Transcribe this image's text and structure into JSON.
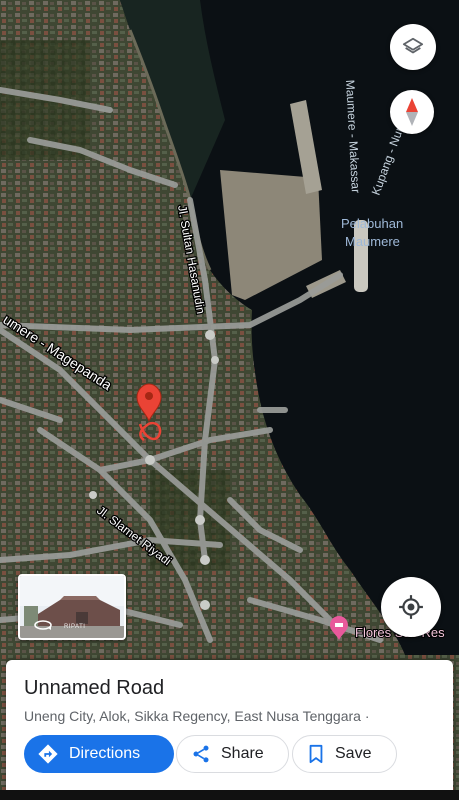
{
  "map": {
    "labels": {
      "road_sultan_hasanudin": "Jl. Sultan Hasanudin",
      "road_maumere_magepanda": "umere - Magepanda",
      "road_slamet_riyadi": "Jl. Slamet Riyadi",
      "sea_route_makassar": "Maumere - Makassar",
      "sea_route_kupang": "Kupang - Num",
      "port_name_line1": "Pelabuhan",
      "port_name_line2": "Maumere",
      "poi_flores_label": "Flores Sao Res"
    },
    "colors": {
      "pin": "#ea4335",
      "poi_pin": "#e8599b",
      "sea": "#0b1014",
      "land": "#3e4631",
      "road": "#9a9c99"
    },
    "selected_area_outline": "red"
  },
  "controls": {
    "layers_icon": "layers-icon",
    "compass_icon": "compass-icon",
    "location_icon": "my-location-icon"
  },
  "streetview": {
    "watermark": "RIPATI"
  },
  "place": {
    "title": "Unnamed Road",
    "address": "Uneng City, Alok, Sikka Regency, East Nusa Tenggara ·"
  },
  "actions": {
    "directions_label": "Directions",
    "share_label": "Share",
    "save_label": "Save"
  }
}
